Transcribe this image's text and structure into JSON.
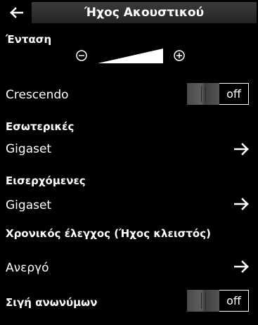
{
  "header": {
    "title": "Ήχος Ακουστικού"
  },
  "volume": {
    "label": "Ένταση",
    "level": 1.0
  },
  "crescendo": {
    "label": "Crescendo",
    "state": "off"
  },
  "internal": {
    "label": "Εσωτερικές",
    "value": "Gigaset"
  },
  "incoming": {
    "label": "Εισερχόμενες",
    "value": "Gigaset"
  },
  "timer": {
    "label": "Χρονικός έλεγχος (Ήχος κλειστός)",
    "value": "Ανεργό"
  },
  "anon": {
    "label": "Σιγή ανωνύμων",
    "state": "off"
  }
}
